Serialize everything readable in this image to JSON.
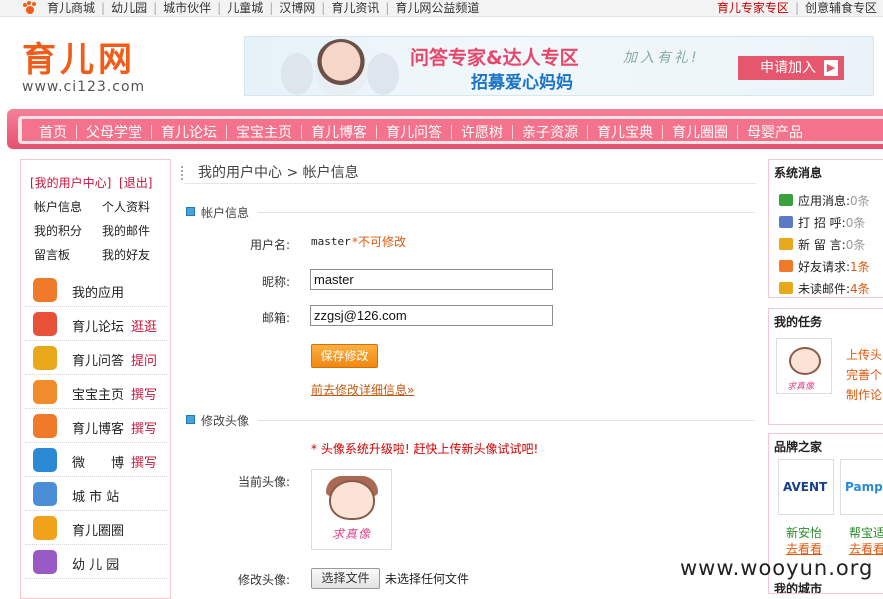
{
  "topbar": {
    "left_links": [
      "育儿商城",
      "幼儿园",
      "城市伙伴",
      "儿童城",
      "汉博网",
      "育儿资讯",
      "育儿网公益频道"
    ],
    "right_links": [
      "育儿专家专区",
      "创意辅食专区"
    ]
  },
  "logo": {
    "name": "育儿网",
    "url": "www.ci123.com"
  },
  "banner": {
    "title": "问答专家&达人专区",
    "subtitle": "招募爱心妈妈",
    "slogan": "加入有礼!",
    "join_label": "申请加入"
  },
  "nav": {
    "items": [
      "首页",
      "父母学堂",
      "育儿论坛",
      "宝宝主页",
      "育儿博客",
      "育儿问答",
      "许愿树",
      "亲子资源",
      "育儿宝典",
      "育儿圈圈",
      "母婴产品"
    ]
  },
  "sidebar": {
    "user_center": "[我的用户中心]",
    "logout": "[退出]",
    "links": [
      "帐户信息",
      "个人资料",
      "我的积分",
      "我的邮件",
      "留言板",
      "我的好友"
    ],
    "apps": [
      {
        "name": "我的应用",
        "action": "",
        "color": "#f07a2a"
      },
      {
        "name": "育儿论坛",
        "action": "逛逛",
        "color": "#e8503a"
      },
      {
        "name": "育儿问答",
        "action": "提问",
        "color": "#e8a81a"
      },
      {
        "name": "宝宝主页",
        "action": "撰写",
        "color": "#f08d2a"
      },
      {
        "name": "育儿博客",
        "action": "撰写",
        "color": "#f07a2a"
      },
      {
        "name": "微　　博",
        "action": "撰写",
        "color": "#2a8ad6"
      },
      {
        "name": "城 市 站",
        "action": "",
        "color": "#4b8ed8"
      },
      {
        "name": "育儿圈圈",
        "action": "",
        "color": "#f0a21a"
      },
      {
        "name": "幼 儿 园",
        "action": "",
        "color": "#9a5ac6"
      }
    ]
  },
  "main": {
    "breadcrumb": "我的用户中心 > 帐户信息",
    "account_section": "帐户信息",
    "username_label": "用户名:",
    "username_value": "master",
    "username_note": "*不可修改",
    "nickname_label": "昵称:",
    "nickname_value": "master",
    "email_label": "邮箱:",
    "email_value": "zzgsj@126.com",
    "save_label": "保存修改",
    "detail_link": "前去修改详细信息»",
    "avatar_section": "修改头像",
    "avatar_warning": "* 头像系统升级啦! 赶快上传新头像试试吧!",
    "current_avatar_label": "当前头像:",
    "avatar_caption": "求真像",
    "change_avatar_label": "修改头像:",
    "file_button": "选择文件",
    "no_file": "未选择任何文件"
  },
  "right": {
    "messages_title": "系统消息",
    "messages": [
      {
        "label": "应用消息:",
        "count": "0条",
        "color": "#3aa03a"
      },
      {
        "label": "打 招 呼:",
        "count": "0条",
        "color": "#5a7ac6"
      },
      {
        "label": "新 留 言:",
        "count": "0条",
        "color": "#e8a81a"
      },
      {
        "label": "好友请求:",
        "count": "1条",
        "color": "#f07a2a"
      },
      {
        "label": "未读邮件:",
        "count": "4条",
        "color": "#e8a81a"
      }
    ],
    "tasks_title": "我的任务",
    "task_lines": [
      "上传头",
      "完善个",
      "制作论"
    ],
    "task_caption": "求真像",
    "brands_title": "品牌之家",
    "brands": [
      {
        "logo": "AVENT",
        "name": "新安怡",
        "link": "去看看",
        "color": "#1a3e8a"
      },
      {
        "logo": "Pampers",
        "name": "帮宝适",
        "link": "去看看",
        "color": "#2a8ad6"
      }
    ],
    "city_title": "我的城市"
  },
  "watermark": "www.wooyun.org"
}
